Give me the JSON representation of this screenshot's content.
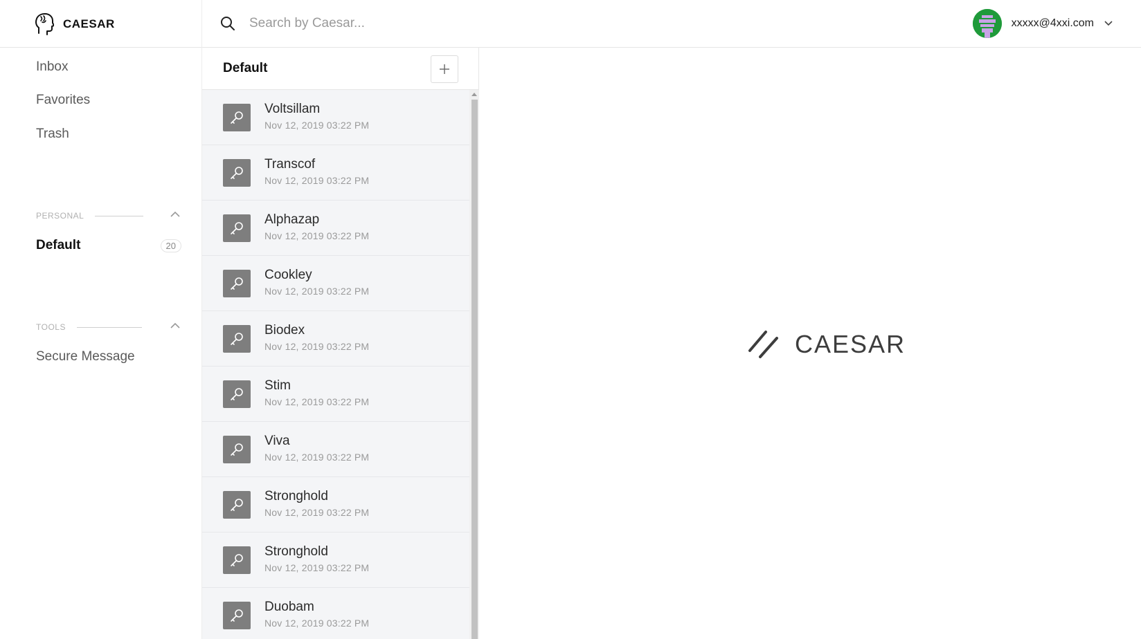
{
  "brand": {
    "name": "CAESAR"
  },
  "search": {
    "placeholder": "Search by Caesar..."
  },
  "account": {
    "email": "xxxxx@4xxi.com",
    "avatar_color": "#1f9a3a"
  },
  "sidebar": {
    "nav": [
      {
        "label": "Inbox"
      },
      {
        "label": "Favorites"
      },
      {
        "label": "Trash"
      }
    ],
    "personal": {
      "label": "PERSONAL",
      "folders": [
        {
          "name": "Default",
          "count": "20"
        }
      ]
    },
    "tools": {
      "label": "TOOLS",
      "items": [
        {
          "label": "Secure Message"
        }
      ]
    }
  },
  "list": {
    "title": "Default",
    "items": [
      {
        "name": "Voltsillam",
        "date": "Nov 12, 2019 03:22 PM"
      },
      {
        "name": "Transcof",
        "date": "Nov 12, 2019 03:22 PM"
      },
      {
        "name": "Alphazap",
        "date": "Nov 12, 2019 03:22 PM"
      },
      {
        "name": "Cookley",
        "date": "Nov 12, 2019 03:22 PM"
      },
      {
        "name": "Biodex",
        "date": "Nov 12, 2019 03:22 PM"
      },
      {
        "name": "Stim",
        "date": "Nov 12, 2019 03:22 PM"
      },
      {
        "name": "Viva",
        "date": "Nov 12, 2019 03:22 PM"
      },
      {
        "name": "Stronghold",
        "date": "Nov 12, 2019 03:22 PM"
      },
      {
        "name": "Stronghold",
        "date": "Nov 12, 2019 03:22 PM"
      },
      {
        "name": "Duobam",
        "date": "Nov 12, 2019 03:22 PM"
      }
    ]
  },
  "main": {
    "logo_text": "CAESAR"
  },
  "colors": {
    "list_bg": "#f4f5f7",
    "item_icon_bg": "#7e7e7e",
    "avatar": "#1f9a3a"
  }
}
